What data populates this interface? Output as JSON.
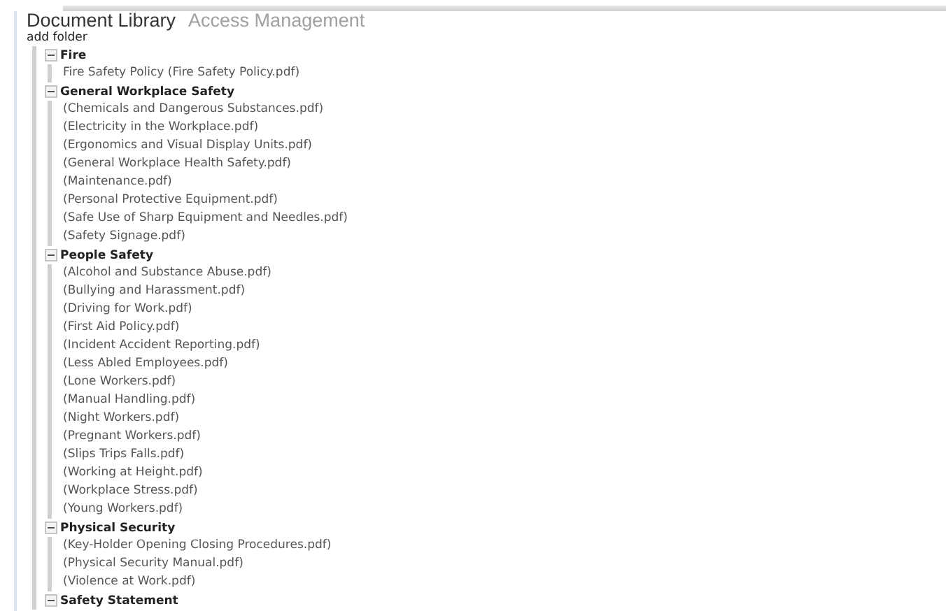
{
  "tabs": [
    {
      "label": "Document Library",
      "selected": true
    },
    {
      "label": "Access Management",
      "selected": false
    }
  ],
  "add_folder": "add folder",
  "tree": {
    "folders": [
      {
        "label": "Fire",
        "expanded": true,
        "children": [
          {
            "label": "Fire Safety Policy (Fire Safety Policy.pdf)"
          }
        ]
      },
      {
        "label": "General Workplace Safety",
        "expanded": true,
        "children": [
          {
            "label": "(Chemicals and Dangerous Substances.pdf)"
          },
          {
            "label": "(Electricity in the Workplace.pdf)"
          },
          {
            "label": "(Ergonomics and Visual Display Units.pdf)"
          },
          {
            "label": "(General Workplace Health Safety.pdf)"
          },
          {
            "label": "(Maintenance.pdf)"
          },
          {
            "label": "(Personal Protective Equipment.pdf)"
          },
          {
            "label": "(Safe Use of Sharp Equipment and Needles.pdf)"
          },
          {
            "label": "(Safety Signage.pdf)"
          }
        ]
      },
      {
        "label": "People Safety",
        "expanded": true,
        "children": [
          {
            "label": "(Alcohol and Substance Abuse.pdf)"
          },
          {
            "label": "(Bullying and Harassment.pdf)"
          },
          {
            "label": "(Driving for Work.pdf)"
          },
          {
            "label": "(First Aid Policy.pdf)"
          },
          {
            "label": "(Incident Accident Reporting.pdf)"
          },
          {
            "label": "(Less Abled Employees.pdf)"
          },
          {
            "label": "(Lone Workers.pdf)"
          },
          {
            "label": "(Manual Handling.pdf)"
          },
          {
            "label": "(Night Workers.pdf)"
          },
          {
            "label": "(Pregnant Workers.pdf)"
          },
          {
            "label": "(Slips Trips Falls.pdf)"
          },
          {
            "label": "(Working at Height.pdf)"
          },
          {
            "label": "(Workplace Stress.pdf)"
          },
          {
            "label": "(Young Workers.pdf)"
          }
        ]
      },
      {
        "label": "Physical Security",
        "expanded": true,
        "children": [
          {
            "label": "(Key-Holder Opening Closing Procedures.pdf)"
          },
          {
            "label": "(Physical Security Manual.pdf)"
          },
          {
            "label": "(Violence at Work.pdf)"
          }
        ]
      },
      {
        "label": "Safety Statement",
        "expanded": true
      }
    ]
  }
}
